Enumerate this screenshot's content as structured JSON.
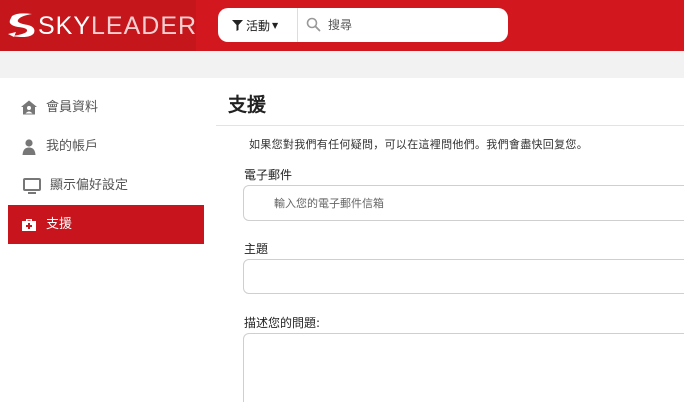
{
  "header": {
    "logo_sky": "SKY",
    "logo_leader": "LEADER",
    "activity_label": "活動",
    "search_placeholder": "搜尋"
  },
  "sidebar": {
    "items": [
      {
        "label": "會員資料",
        "icon": "home-user-icon",
        "active": false
      },
      {
        "label": "我的帳戶",
        "icon": "person-icon",
        "active": false
      },
      {
        "label": "顯示偏好設定",
        "icon": "monitor-icon",
        "active": false
      },
      {
        "label": "支援",
        "icon": "first-aid-kit-icon",
        "active": true
      }
    ]
  },
  "main": {
    "title": "支援",
    "intro": "如果您對我們有任何疑問，可以在這裡問他們。我們會盡快回复您。",
    "email_label": "電子郵件",
    "email_placeholder": "輸入您的電子郵件信箱",
    "subject_label": "主題",
    "subject_value": "",
    "description_label": "描述您的問題:"
  },
  "colors": {
    "brand_red": "#d3171e",
    "active_red": "#c8141c"
  }
}
